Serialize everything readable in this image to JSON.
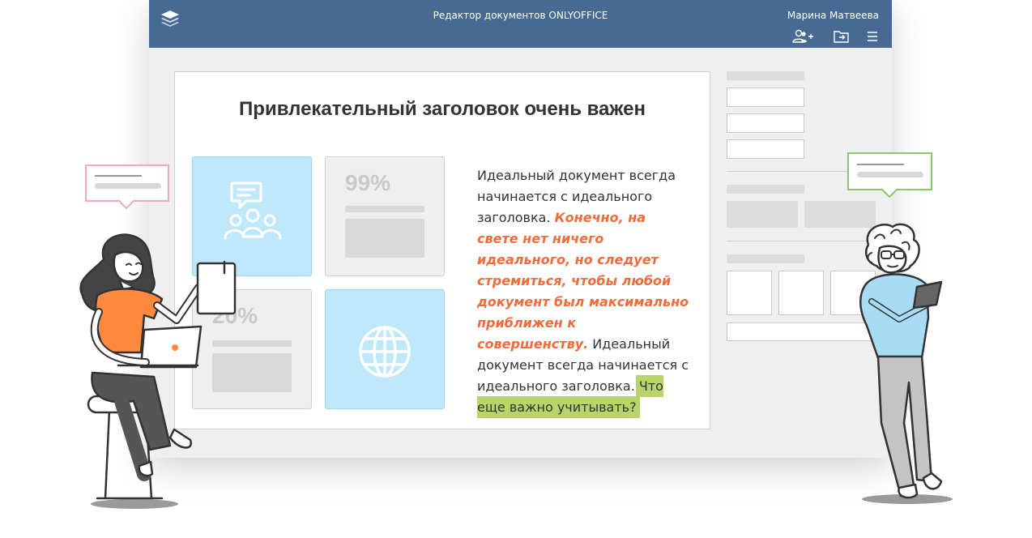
{
  "titlebar": {
    "app_title": "Редактор документов ONLYOFFICE",
    "user_name": "Марина Матвеева",
    "icons": [
      "layers-logo-icon",
      "add-user-icon",
      "folder-open-icon",
      "menu-icon"
    ]
  },
  "document": {
    "heading": "Привлекательный заголовок очень важен",
    "tiles": [
      {
        "kind": "icon",
        "icon": "people-chat-icon"
      },
      {
        "kind": "stat",
        "value": "99%"
      },
      {
        "kind": "stat",
        "value": "20%"
      },
      {
        "kind": "icon",
        "icon": "globe-icon"
      }
    ],
    "paragraph": {
      "plain1": "Идеальный документ всегда начинается с идеального заголовка. ",
      "emphasis": "Конечно, на свете нет ничего идеального, но следует стремиться, чтобы любой документ был максимально приближен к совершенству.",
      "plain2": " Идеальный документ всегда начинается с идеального заголовка. ",
      "highlight": "Что еще важно учитывать?"
    }
  },
  "colors": {
    "titlebar": "#476993",
    "emphasis": "#f26c3b",
    "highlight": "#b9d46a",
    "tile_blue": "#bfe8fb",
    "comment_pink": "#f3a9bd",
    "comment_green": "#8cc66b",
    "shirt_orange": "#ff8a3d",
    "shirt_blue": "#a8dcf5"
  }
}
